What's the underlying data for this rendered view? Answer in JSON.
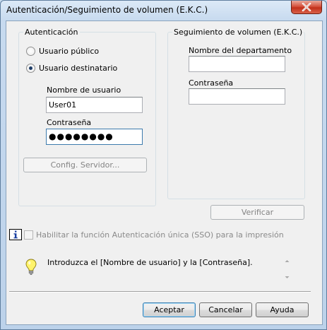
{
  "window": {
    "title": "Autenticación/Seguimiento de volumen (E.K.C.)"
  },
  "authentication": {
    "group_title": "Autenticación",
    "radio_public": "Usuario público",
    "radio_recipient": "Usuario destinatario",
    "selected": "recipient",
    "username_label": "Nombre de usuario",
    "username_value": "User01",
    "password_label": "Contraseña",
    "password_value": "●●●●●●●●",
    "server_button": "Config. Servidor..."
  },
  "tracking": {
    "group_title": "Seguimiento de volumen (E.K.C.)",
    "department_label": "Nombre del departamento",
    "department_value": "",
    "password_label": "Contraseña",
    "password_value": ""
  },
  "verify_button": "Verificar",
  "sso": {
    "label": "Habilitar la función Autenticación única (SSO) para la impresión",
    "checked": false,
    "enabled": false
  },
  "message": {
    "text": "Introduzca el [Nombre de usuario] y la [Contraseña]."
  },
  "buttons": {
    "ok": "Aceptar",
    "cancel": "Cancelar",
    "help": "Ayuda"
  }
}
